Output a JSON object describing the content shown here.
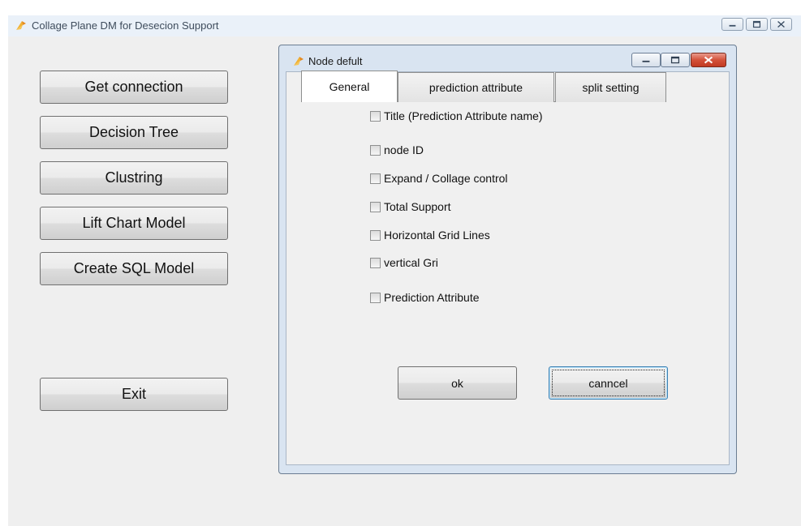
{
  "main_window": {
    "title": "Collage Plane DM for Desecion Support",
    "icon": "app-logo-icon"
  },
  "sidebar": {
    "buttons": [
      {
        "label": "Get connection"
      },
      {
        "label": "Decision Tree"
      },
      {
        "label": "Clustring"
      },
      {
        "label": "Lift Chart Model"
      },
      {
        "label": "Create SQL Model"
      },
      {
        "label": "Exit"
      }
    ]
  },
  "dialog": {
    "title": "Node defult",
    "icon": "app-logo-icon",
    "tabs": [
      {
        "label": "General",
        "active": true
      },
      {
        "label": "prediction attribute",
        "active": false
      },
      {
        "label": "split setting",
        "active": false
      }
    ],
    "options": [
      {
        "label": "Title (Prediction Attribute name)",
        "checked": false
      },
      {
        "label": "node ID",
        "checked": false
      },
      {
        "label": "Expand / Collage control",
        "checked": false
      },
      {
        "label": "Total Support",
        "checked": false
      },
      {
        "label": "Horizontal Grid Lines",
        "checked": false
      },
      {
        "label": "vertical Gri",
        "checked": false
      },
      {
        "label": "Prediction Attribute",
        "checked": false
      }
    ],
    "ok_label": "ok",
    "cancel_label": "canncel"
  },
  "colors": {
    "close_button": "#c13a22",
    "focus_border": "#3c7fb1",
    "window_frame": "#e8eff6"
  }
}
